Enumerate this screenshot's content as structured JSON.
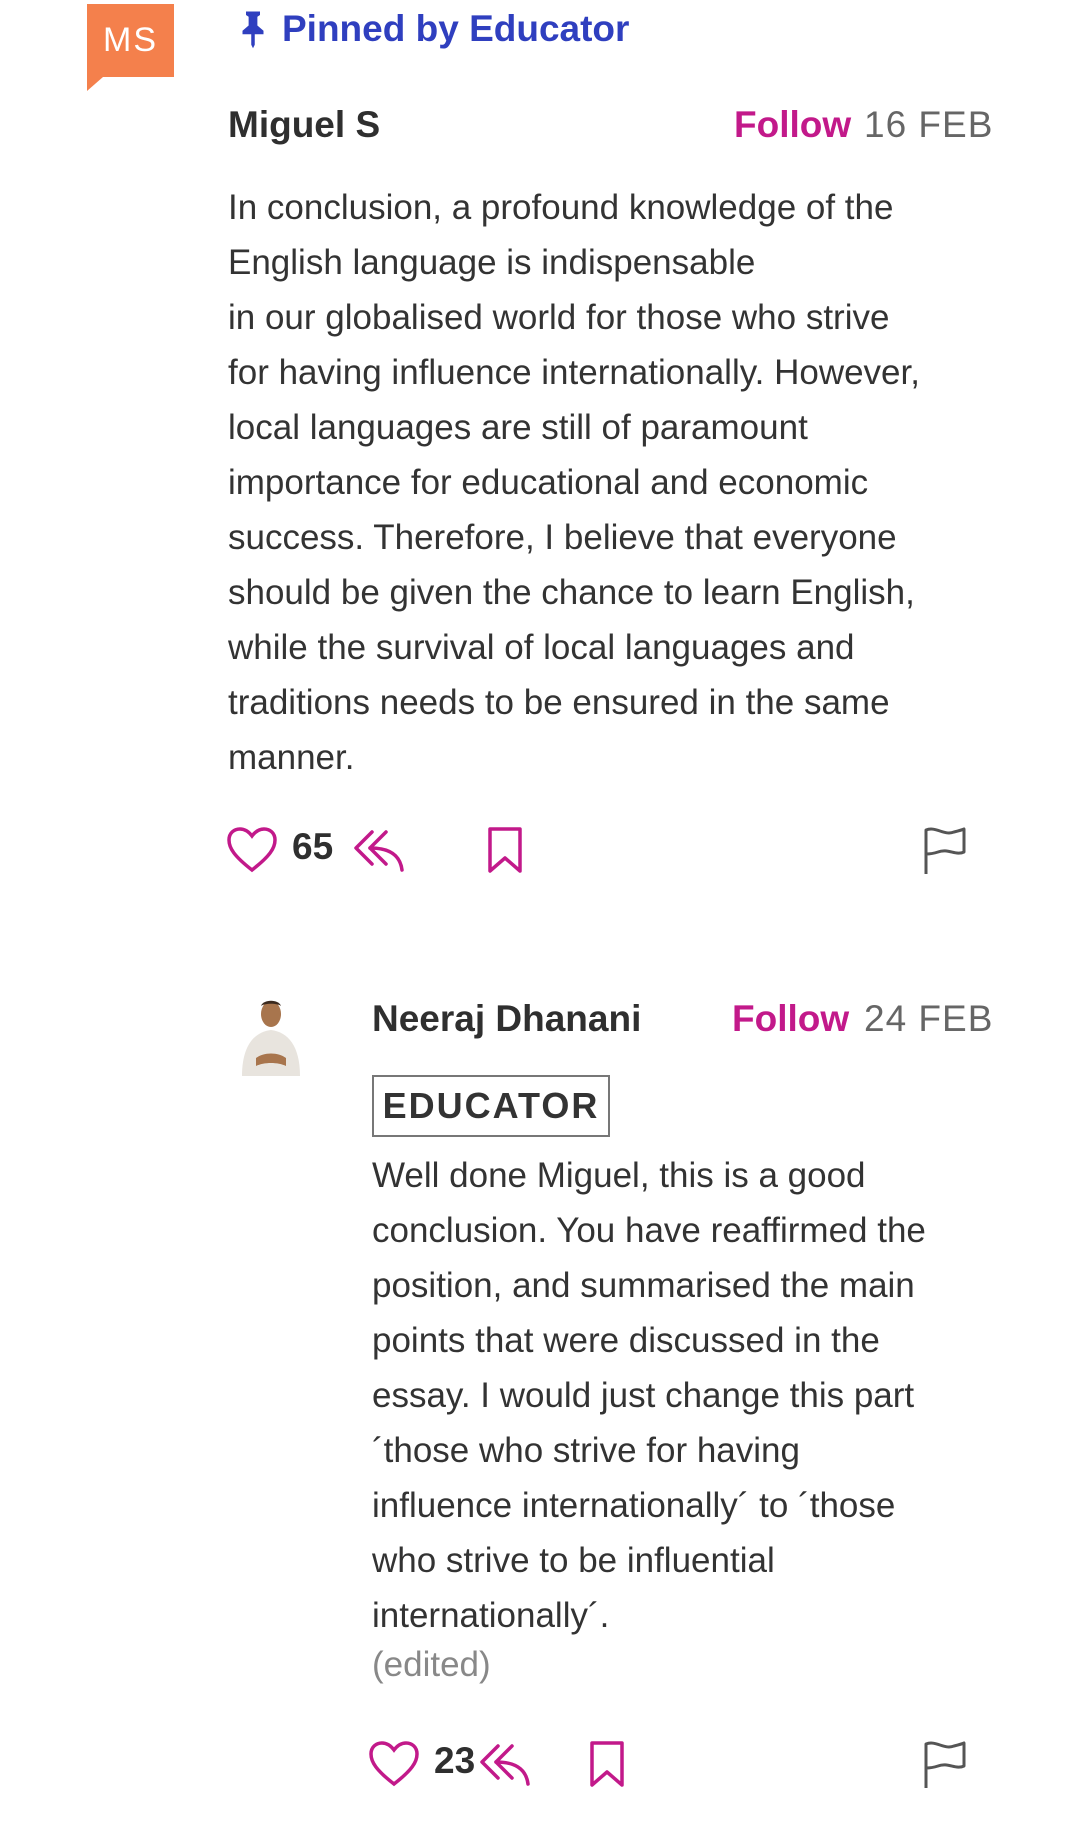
{
  "pinned": {
    "label": "Pinned by Educator",
    "icon": "pin-icon",
    "color": "#2f3fbf"
  },
  "comment": {
    "avatar_initials": "MS",
    "avatar_color": "#f4804c",
    "author": "Miguel S",
    "follow_label": "Follow",
    "date": "16 FEB",
    "text": "In conclusion, a profound knowledge of the\nEnglish language is indispensable\nin our globalised world for those who strive\nfor having influence internationally. However,\nlocal languages are still of paramount\nimportance for educational and economic\nsuccess. Therefore, I believe that everyone\nshould be given the chance to learn English,\nwhile the survival of local languages and\ntraditions needs to be ensured in the same\nmanner.",
    "likes": "65"
  },
  "reply": {
    "author": "Neeraj Dhanani",
    "follow_label": "Follow",
    "date": "24 FEB",
    "badge": "EDUCATOR",
    "text": "Well done Miguel, this is a good\nconclusion. You have reaffirmed the\nposition, and summarised the main\npoints that were discussed in the\nessay. I would just change this part\n´those who strive for having\ninfluence internationally´ to ´those\nwho strive to be influential\ninternationally´.",
    "edited_label": "(edited)",
    "likes": "23"
  },
  "colors": {
    "accent": "#c2198a",
    "text": "#333333"
  }
}
